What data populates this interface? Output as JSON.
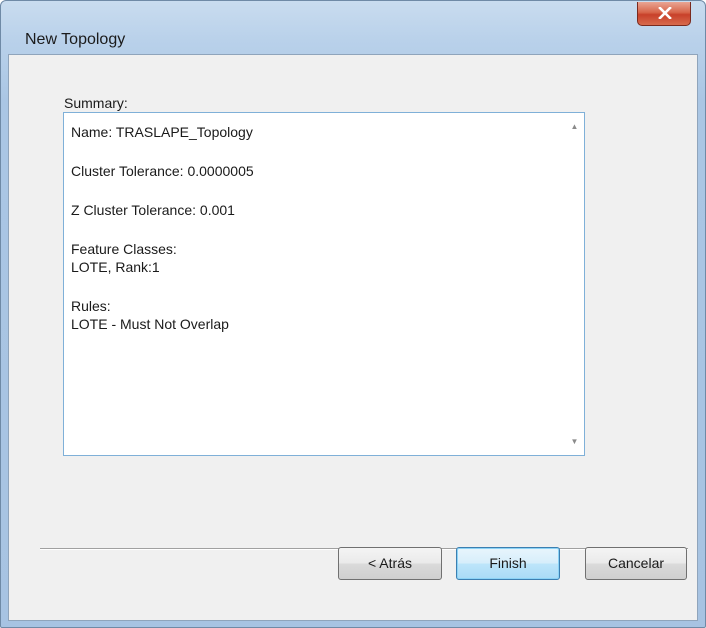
{
  "window": {
    "title": "New Topology"
  },
  "summary": {
    "label": "Summary:",
    "blocks": [
      [
        "Name: TRASLAPE_Topology"
      ],
      [
        "Cluster Tolerance: 0.0000005"
      ],
      [
        "Z Cluster Tolerance: 0.001"
      ],
      [
        "Feature Classes:",
        "LOTE, Rank:1"
      ],
      [
        "Rules:",
        "LOTE - Must Not Overlap"
      ]
    ]
  },
  "buttons": {
    "back_label": "< Atrás",
    "finish_label": "Finish",
    "cancel_label": "Cancelar"
  },
  "icons": {
    "close": "close-icon",
    "scroll_up": "scroll-up-arrow-icon",
    "scroll_down": "scroll-down-arrow-icon"
  },
  "colors": {
    "close_button": "#c8412a",
    "default_button_border": "#3c7fb1",
    "summary_border": "#7fb0d8"
  }
}
